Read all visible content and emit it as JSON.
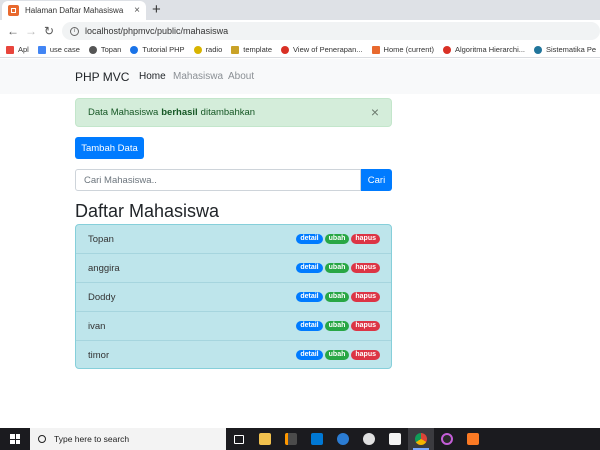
{
  "browser": {
    "tab_title": "Halaman Daftar Mahasiswa",
    "tab_close": "×",
    "new_tab": "+",
    "url": "localhost/phpmvc/public/mahasiswa",
    "bookmarks": [
      {
        "label": "Apl",
        "icon": "apps-grid-icon",
        "color": "#e8453c"
      },
      {
        "label": "use case",
        "icon": "doc-icon",
        "color": "#4285f4"
      },
      {
        "label": "Topan",
        "icon": "globe-icon",
        "color": "#555555"
      },
      {
        "label": "Tutorial PHP",
        "icon": "site-icon",
        "color": "#1a73e8"
      },
      {
        "label": "radio",
        "icon": "radio-icon",
        "color": "#d8b400"
      },
      {
        "label": "template",
        "icon": "template-icon",
        "color": "#c9a227"
      },
      {
        "label": "View of Penerapan...",
        "icon": "site-icon",
        "color": "#d93025"
      },
      {
        "label": "Home (current)",
        "icon": "site-icon",
        "color": "#e8692e"
      },
      {
        "label": "Algoritma Hierarchi...",
        "icon": "site-icon",
        "color": "#d93025"
      },
      {
        "label": "Sistematika Pe",
        "icon": "wordpress-icon",
        "color": "#21759b"
      }
    ]
  },
  "navbar": {
    "brand": "PHP MVC",
    "links": [
      "Home",
      "Mahasiswa",
      "About"
    ]
  },
  "alert": {
    "prefix": "Data Mahasiswa",
    "bold": "berhasil",
    "suffix": "ditambahkan",
    "close": "×"
  },
  "add_button": "Tambah Data",
  "search": {
    "placeholder": "Cari Mahasiswa..",
    "button": "Cari"
  },
  "heading": "Daftar Mahasiswa",
  "students": [
    {
      "name": "Topan"
    },
    {
      "name": "anggira"
    },
    {
      "name": "Doddy"
    },
    {
      "name": "ivan"
    },
    {
      "name": "timor"
    }
  ],
  "badge_labels": {
    "detail": "detail",
    "ubah": "ubah",
    "hapus": "hapus"
  },
  "taskbar": {
    "search_text": "Type here to search"
  }
}
